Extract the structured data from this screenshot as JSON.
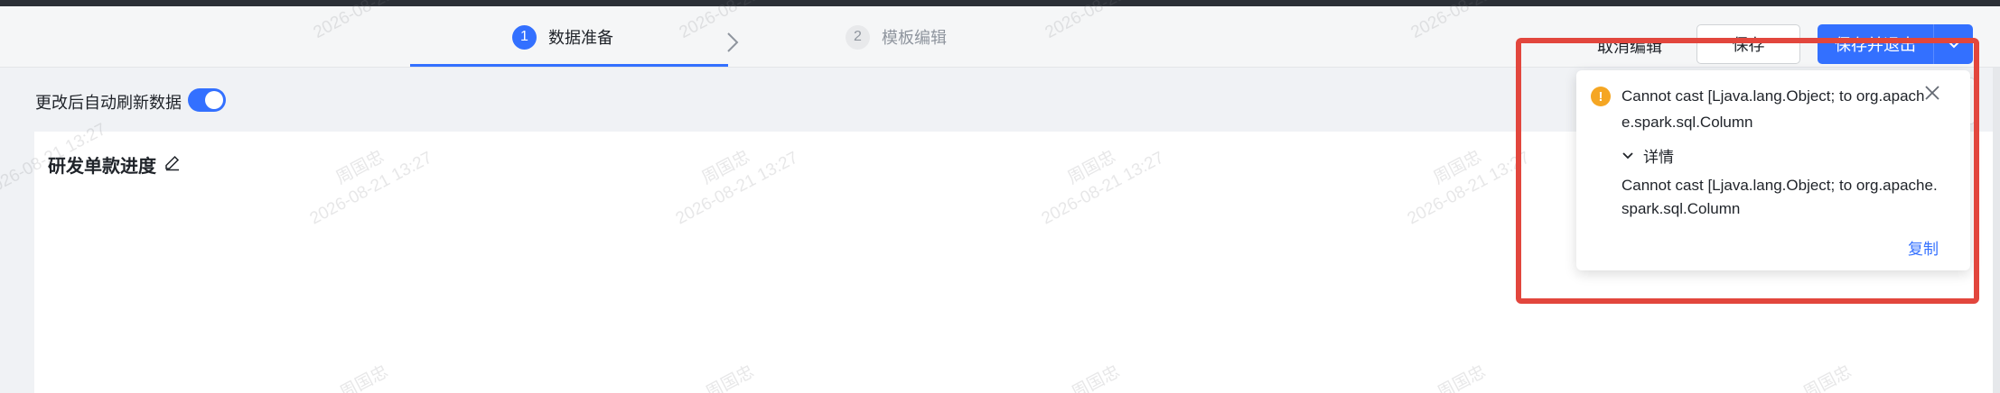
{
  "steps": [
    {
      "number": "1",
      "label": "数据准备"
    },
    {
      "number": "2",
      "label": "模板编辑"
    }
  ],
  "header_actions": {
    "cancel_label": "取消编辑",
    "save_label": "保存",
    "save_and_exit_label": "保存并退出"
  },
  "toolbar": {
    "auto_refresh_label": "更改后自动刷新数据",
    "auto_refresh_on": true
  },
  "card": {
    "title": "研发单款进度"
  },
  "watermark": {
    "name": "周国忠",
    "timestamp": "2026-08-21 13:27"
  },
  "toast": {
    "title": "Cannot cast [Ljava.lang.Object; to org.apache.spark.sql.Column",
    "details_label": "详情",
    "detail_message": "Cannot cast [Ljava.lang.Object; to org.apache.spark.sql.Column",
    "copy_label": "复制"
  },
  "colors": {
    "accent": "#3370ff",
    "warning": "#f5a623",
    "highlight": "#e2463d"
  },
  "icons": [
    "chevron-right-icon",
    "chevron-down-icon",
    "edit-icon",
    "warning-icon",
    "close-icon",
    "caret-down-icon"
  ]
}
